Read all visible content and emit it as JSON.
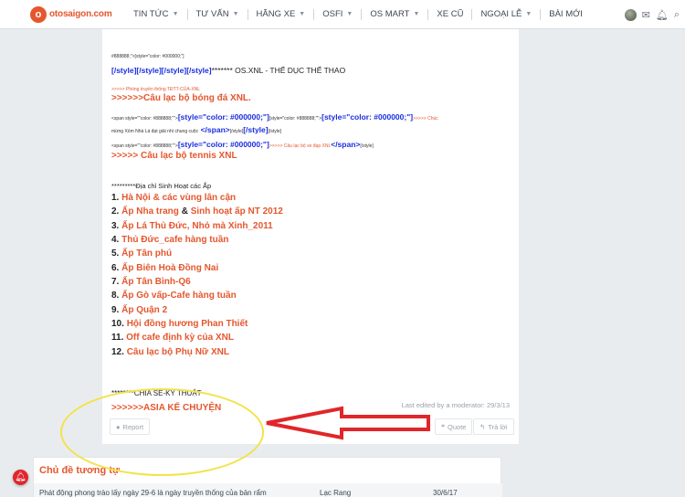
{
  "header": {
    "logo_text": "otosaigon.com",
    "nav": [
      {
        "label": "TIN TỨC",
        "dropdown": true
      },
      {
        "label": "TƯ VẤN",
        "dropdown": true
      },
      {
        "label": "HÃNG XE",
        "dropdown": true
      },
      {
        "label": "OSFI",
        "dropdown": true
      },
      {
        "label": "OS MART",
        "dropdown": true
      },
      {
        "label": "XE CŨ",
        "dropdown": false
      },
      {
        "label": "NGOẠI LỄ",
        "dropdown": true
      },
      {
        "label": "BÀI MỚI",
        "dropdown": false
      }
    ],
    "icons": [
      "avatar",
      "mail-icon",
      "bell-icon",
      "search-icon"
    ]
  },
  "post": {
    "line1_code": "#888888;\">[style=\"color: #000000;\"]",
    "line2_blue": "[/style][/style][/style][/style]",
    "line2_tail": "******* OS.XNL - THỂ DỤC THỂ THAO",
    "line3_red_small": ">>>>> Phòng truyền thống TĐTT-CỦA-XNL",
    "line4": ">>>>>>Câu lạc bộ bóng đá XNL.",
    "line5_small_a": "<span style=\"\"color: #888888;\"\">",
    "line5_blue_a": "[style=\"color: #000000;\"]",
    "line5_small_b": "[style=\"color: #888888;\"\">",
    "line5_blue_b": "[style=\"color: #000000;\"]",
    "line5_red_small": ">>>>> Chúc",
    "line6_small": "mừng Xóm Nhà Lá đạt giải nhì chung cuộc",
    "line6_blue": "</span>",
    "line6_small_b": "[/style]",
    "line6_blue_b": "[/style]",
    "line6_small_c": "[/style]",
    "line7_small_a": "<span style=\"\"color: #888888;\"\">",
    "line7_blue": "[style=\"color: #000000;\"]",
    "line7_red_small": ">>>>> Câu lạc bộ xe đạp XNL",
    "line7_blue_b": "</span>",
    "line7_small_b": "[/style]",
    "line8": ">>>>> Câu lạc bộ tennis XNL",
    "section_addresses": "*********Địa chỉ Sinh Hoạt các Ấp",
    "addresses": [
      {
        "num": "1.",
        "text": "Hà Nội & các vùng lân cận"
      },
      {
        "num": "2.",
        "text": "Ấp Nha trang",
        "amp": "&",
        "text2": "Sinh hoạt ấp NT 2012"
      },
      {
        "num": "3.",
        "text": "Ấp Lá Thủ Đức, Nhỏ mà Xinh_2011"
      },
      {
        "num": "4.",
        "text": "Thủ Đức_cafe hàng tuần"
      },
      {
        "num": "5.",
        "text": "Ấp Tân phú"
      },
      {
        "num": "6.",
        "text": "Ấp Biên Hoà Đồng Nai"
      },
      {
        "num": "7.",
        "text": "Ấp Tân Bình-Q6"
      },
      {
        "num": "8.",
        "text": "Ấp Gò vấp-Cafe hàng tuần"
      },
      {
        "num": "9.",
        "text": "Ấp Quận 2"
      },
      {
        "num": "10.",
        "text": "Hội đồng hương Phan Thiết"
      },
      {
        "num": "11.",
        "text": "Off cafe định kỳ của XNL"
      },
      {
        "num": "12.",
        "text": "Câu lạc bộ Phụ Nữ XNL"
      }
    ],
    "section_tech": "********CHIA SẺ-KỸ THUẬT",
    "tech_link": ">>>>>>ASIA KỂ CHUYỆN",
    "edited_note": "Last edited by a moderator: 29/3/13"
  },
  "actions": {
    "report": "Report",
    "quote": "Quote",
    "reply": "Trả lời"
  },
  "similar": {
    "title": "Chủ đề tương tự",
    "row": {
      "thread": "Phát động phong trào lấy ngày 29-6 là ngày truyền thống của bản rẩm",
      "forum": "Lạc Rang",
      "date": "30/6/17"
    }
  },
  "colors": {
    "accent": "#e4572e",
    "code_blue": "#1a2ee0",
    "annotation_yellow": "#f3e24a",
    "annotation_red": "#e0262a"
  }
}
